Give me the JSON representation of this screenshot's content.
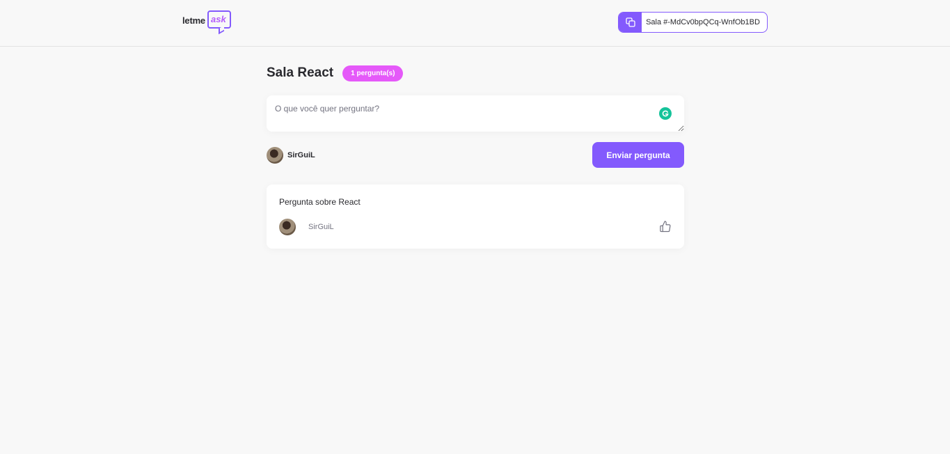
{
  "header": {
    "logo": {
      "part1": "letme",
      "part2": "ask"
    },
    "room_code": {
      "label": "Sala #-MdCv0bpQCq-WnfOb1BD",
      "icon": "copy-icon"
    }
  },
  "room": {
    "title": "Sala React",
    "question_count_badge": "1 pergunta(s)"
  },
  "form": {
    "placeholder": "O que você quer perguntar?",
    "value": "",
    "user_name": "SirGuiL",
    "submit_label": "Enviar pergunta"
  },
  "questions": [
    {
      "content": "Pergunta sobre React",
      "author": "SirGuiL",
      "like_icon": "thumbs-up-icon"
    }
  ],
  "colors": {
    "accent": "#835afd",
    "badge": "#e559f9",
    "background": "#f8f8f8",
    "grammarly": "#15c39a"
  }
}
